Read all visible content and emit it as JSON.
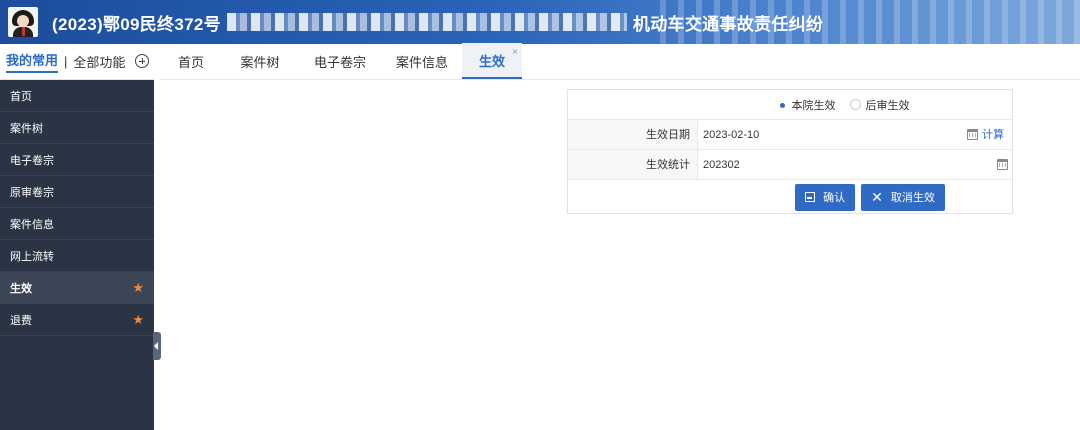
{
  "header": {
    "title_left": "(2023)鄂09民终372号",
    "title_right": "机动车交通事故责任纠纷"
  },
  "sidebar": {
    "tab_active": "我的常用",
    "separator": "|",
    "tab_all": "全部功能",
    "items": [
      {
        "label": "首页"
      },
      {
        "label": "案件树"
      },
      {
        "label": "电子卷宗"
      },
      {
        "label": "原审卷宗"
      },
      {
        "label": "案件信息"
      },
      {
        "label": "网上流转"
      },
      {
        "label": "生效"
      },
      {
        "label": "退费"
      }
    ]
  },
  "tabs": [
    {
      "label": "首页"
    },
    {
      "label": "案件树"
    },
    {
      "label": "电子卷宗"
    },
    {
      "label": "案件信息"
    },
    {
      "label": "生效"
    }
  ],
  "tab_close": "×",
  "form": {
    "radio_options": [
      "本院生效",
      "后审生效"
    ],
    "effective_date_label": "生效日期",
    "effective_date_value": "2023-02-10",
    "calc_label": "计算",
    "effective_stat_label": "生效统计",
    "effective_stat_value": "202302",
    "confirm_label": "确认",
    "cancel_label": "取消生效"
  },
  "colors": {
    "accent": "#2f6bc5",
    "sidebar_bg": "#2b3445",
    "star": "#f0883a"
  }
}
